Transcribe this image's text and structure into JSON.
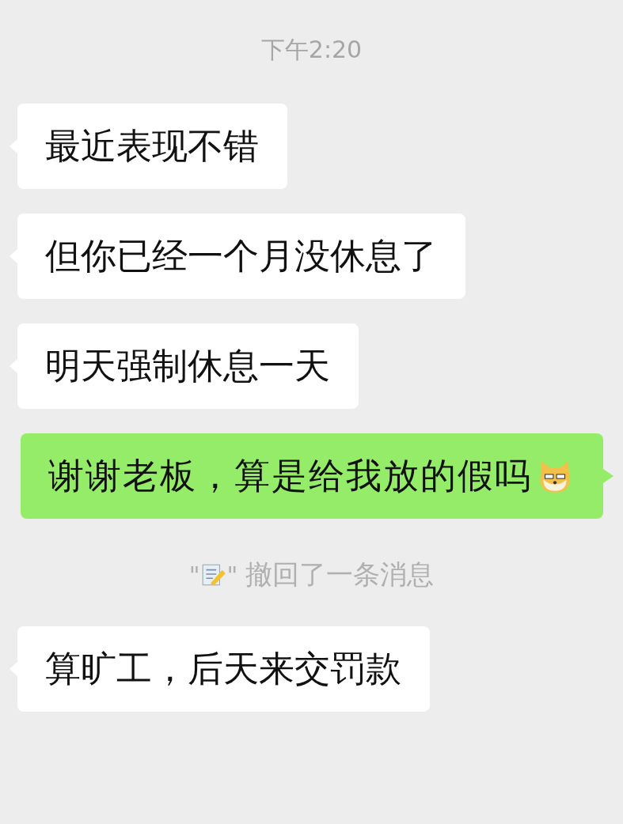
{
  "messages": [
    {
      "kind": "time",
      "text": "下午2:20"
    },
    {
      "kind": "text",
      "outgoing": false,
      "text": "最近表现不错"
    },
    {
      "kind": "text",
      "outgoing": false,
      "text": "但你已经一个月没休息了"
    },
    {
      "kind": "text",
      "outgoing": false,
      "text": "明天强制休息一天"
    },
    {
      "kind": "text",
      "outgoing": true,
      "text": "谢谢老板，算是给我放的假吗",
      "emoji": true
    },
    {
      "kind": "recall",
      "quote_open": "\"",
      "quote_close": "\"",
      "text": "撤回了一条消息"
    },
    {
      "kind": "text",
      "outgoing": false,
      "text": "算旷工，后天来交罚款"
    }
  ]
}
